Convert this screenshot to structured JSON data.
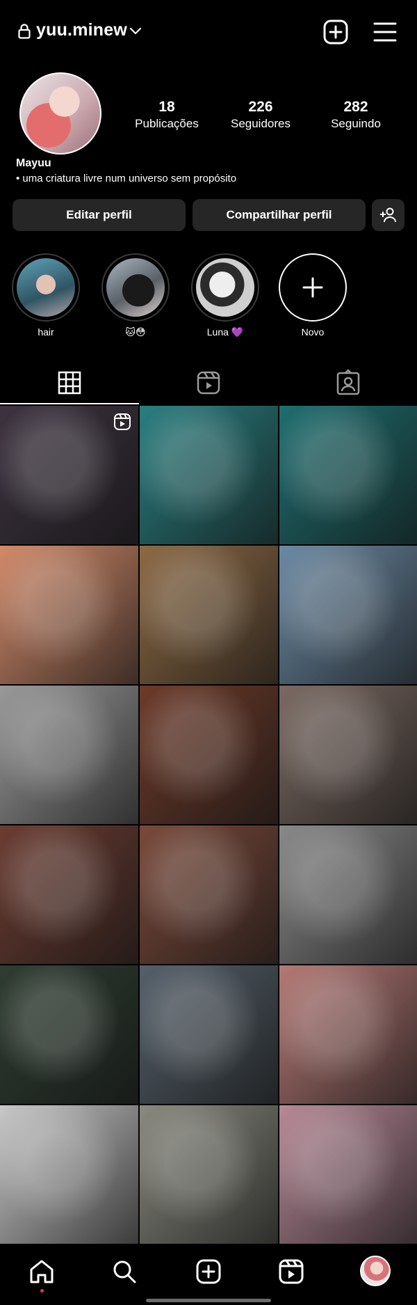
{
  "header": {
    "username": "yuu.minew",
    "icons": [
      "lock-icon",
      "chevron-down-icon",
      "add-post-icon",
      "menu-icon"
    ]
  },
  "profile": {
    "name": "Mayuu",
    "bio": "• uma criatura livre num universo sem propósito",
    "stats": [
      {
        "value": "18",
        "label": "Publicações"
      },
      {
        "value": "226",
        "label": "Seguidores"
      },
      {
        "value": "282",
        "label": "Seguindo"
      }
    ]
  },
  "buttons": {
    "edit": "Editar perfil",
    "share": "Compartilhar perfil",
    "add_person_icon": "add-person-icon"
  },
  "highlights": [
    {
      "label": "hair"
    },
    {
      "label": "🐱😳"
    },
    {
      "label": "Luna 💜"
    },
    {
      "label": "Novo"
    }
  ],
  "tabs": [
    "grid-icon",
    "reels-icon",
    "tagged-icon"
  ],
  "grid": {
    "count": 18,
    "colors": [
      "#3d3340",
      "#2a7f80",
      "#1f6f70",
      "#d28b6a",
      "#8d6a45",
      "#6c8aa3",
      "#9a9a9a",
      "#6d3b2a",
      "#7b6a62",
      "#6b3d32",
      "#7a4a3a",
      "#8a8a8a",
      "#2f3d32",
      "#55606a",
      "#b57a76",
      "#c9c9c9",
      "#8a8a80",
      "#b88a98"
    ]
  },
  "nav": [
    "home-icon",
    "search-icon",
    "create-icon",
    "reels-icon",
    "profile-avatar"
  ],
  "colors": {
    "background": "#000000",
    "button": "#262626",
    "notification": "#ff3040"
  }
}
